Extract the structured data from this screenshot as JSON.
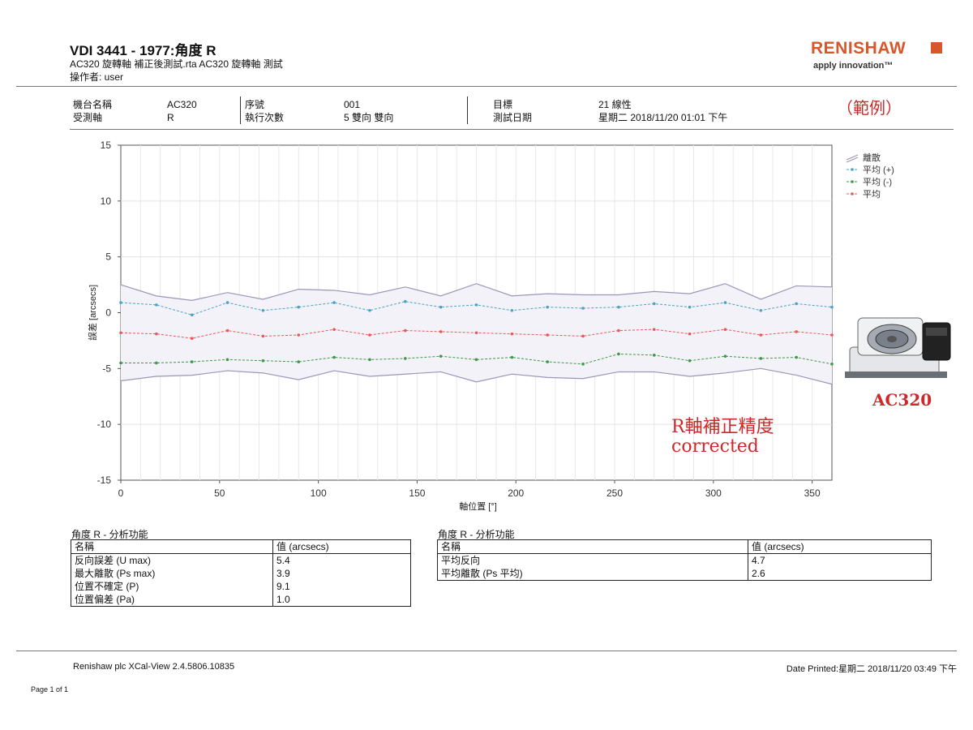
{
  "header": {
    "title": "VDI 3441 - 1977:角度 R",
    "subtitle": "AC320 旋轉軸 補正後測試.rta AC320 旋轉軸 測試",
    "operator": "操作者: user",
    "logo": "RENISHAW",
    "tagline": "apply innovation™"
  },
  "info": {
    "col1_labels": [
      "機台名稱",
      "受測軸"
    ],
    "col1_values": [
      "AC320",
      "R"
    ],
    "col2_labels": [
      "序號",
      "執行次數"
    ],
    "col2_values": [
      "001",
      "5 雙向 雙向"
    ],
    "col3_labels": [
      "目標",
      "測試日期"
    ],
    "col3_values": [
      "21 線性",
      "星期二 2018/11/20 01:01 下午"
    ]
  },
  "example_label": "（範例）",
  "annotation": {
    "line1": "R軸補正精度",
    "line2": "corrected"
  },
  "machine": {
    "label": "AC320",
    "image": "rotary-table-icon"
  },
  "colors": {
    "spread": "#9b96b8",
    "mean_pos": "#4aa3c6",
    "mean_neg": "#3e9a4a",
    "mean": "#e8585a",
    "accent": "#cc2a2a"
  },
  "chart_data": {
    "type": "line",
    "title": "",
    "xlabel": "軸位置 [°]",
    "ylabel": "誤差 [arcsecs]",
    "xlim": [
      0,
      360
    ],
    "ylim": [
      -15,
      15
    ],
    "x_ticks": [
      0,
      50,
      100,
      150,
      200,
      250,
      300,
      350
    ],
    "y_ticks": [
      15,
      10,
      5,
      0,
      -5,
      -10,
      -15
    ],
    "grid": true,
    "legend_position": "top-right",
    "x": [
      0,
      18,
      36,
      54,
      72,
      90,
      108,
      126,
      144,
      162,
      180,
      198,
      216,
      234,
      252,
      270,
      288,
      306,
      324,
      342,
      360
    ],
    "series": [
      {
        "name": "離散",
        "role": "upper",
        "values": [
          2.5,
          1.5,
          1.1,
          1.8,
          1.2,
          2.1,
          2.0,
          1.6,
          2.3,
          1.5,
          2.6,
          1.5,
          1.7,
          1.6,
          1.6,
          1.9,
          1.7,
          2.6,
          1.2,
          2.4,
          2.3
        ]
      },
      {
        "name": "離散",
        "role": "lower",
        "values": [
          -6.1,
          -5.7,
          -5.6,
          -5.2,
          -5.4,
          -6.0,
          -5.2,
          -5.7,
          -5.5,
          -5.3,
          -6.2,
          -5.5,
          -5.8,
          -5.9,
          -5.3,
          -5.3,
          -5.7,
          -5.4,
          -5.0,
          -5.6,
          -6.4
        ]
      },
      {
        "name": "平均 (+)",
        "values": [
          0.9,
          0.7,
          -0.2,
          0.9,
          0.2,
          0.5,
          0.9,
          0.2,
          1.0,
          0.5,
          0.7,
          0.2,
          0.5,
          0.4,
          0.5,
          0.8,
          0.5,
          0.9,
          0.2,
          0.8,
          0.5
        ]
      },
      {
        "name": "平均 (-)",
        "values": [
          -4.5,
          -4.5,
          -4.4,
          -4.2,
          -4.3,
          -4.4,
          -4.0,
          -4.2,
          -4.1,
          -3.9,
          -4.2,
          -4.0,
          -4.4,
          -4.6,
          -3.7,
          -3.8,
          -4.3,
          -3.9,
          -4.1,
          -4.0,
          -4.6
        ]
      },
      {
        "name": "平均",
        "values": [
          -1.8,
          -1.9,
          -2.3,
          -1.6,
          -2.1,
          -2.0,
          -1.5,
          -2.0,
          -1.6,
          -1.7,
          -1.8,
          -1.9,
          -2.0,
          -2.1,
          -1.6,
          -1.5,
          -1.9,
          -1.5,
          -2.0,
          -1.7,
          -2.0
        ]
      }
    ]
  },
  "table1": {
    "title": "角度 R - 分析功能",
    "header": [
      "名稱",
      "值 (arcsecs)"
    ],
    "rows": [
      [
        "反向誤差 (U max)",
        "5.4"
      ],
      [
        "最大離散 (Ps max)",
        "3.9"
      ],
      [
        "位置不確定 (P)",
        "9.1"
      ],
      [
        "位置偏差 (Pa)",
        "1.0"
      ]
    ]
  },
  "table2": {
    "title": "角度 R - 分析功能",
    "header": [
      "名稱",
      "值 (arcsecs)"
    ],
    "rows": [
      [
        "平均反向",
        "4.7"
      ],
      [
        "平均離散 (Ps 平均)",
        "2.6"
      ]
    ]
  },
  "footer": {
    "software": "Renishaw plc XCal-View 2.4.5806.10835",
    "printed": "Date Printed:星期二 2018/11/20 03:49 下午",
    "page": "Page 1 of 1"
  }
}
